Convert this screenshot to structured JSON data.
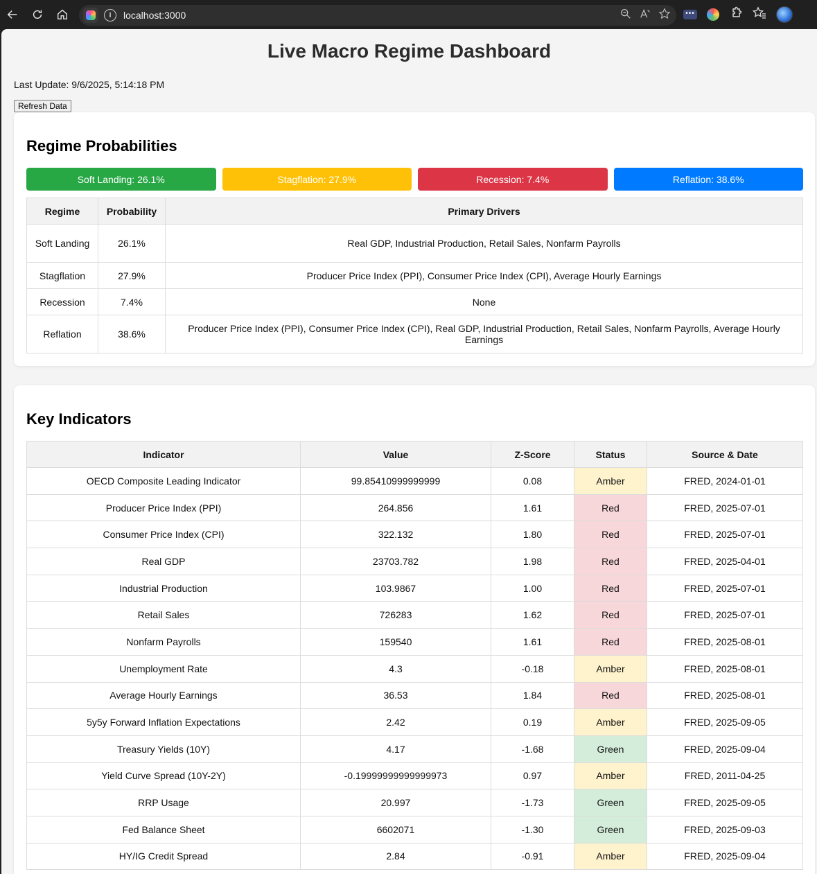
{
  "browser": {
    "url": "localhost:3000"
  },
  "page": {
    "title": "Live Macro Regime Dashboard",
    "last_update": "Last Update: 9/6/2025, 5:14:18 PM",
    "refresh_label": "Refresh Data"
  },
  "regime": {
    "heading": "Regime Probabilities",
    "bars": [
      {
        "label": "Soft Landing: 26.1%",
        "color": "#28a745"
      },
      {
        "label": "Stagflation: 27.9%",
        "color": "#ffc107"
      },
      {
        "label": "Recession: 7.4%",
        "color": "#dc3545"
      },
      {
        "label": "Reflation: 38.6%",
        "color": "#007bff"
      }
    ],
    "columns": [
      "Regime",
      "Probability",
      "Primary Drivers"
    ],
    "rows": [
      {
        "regime": "Soft Landing",
        "probability": "26.1%",
        "drivers": "Real GDP, Industrial Production, Retail Sales, Nonfarm Payrolls"
      },
      {
        "regime": "Stagflation",
        "probability": "27.9%",
        "drivers": "Producer Price Index (PPI), Consumer Price Index (CPI), Average Hourly Earnings"
      },
      {
        "regime": "Recession",
        "probability": "7.4%",
        "drivers": "None"
      },
      {
        "regime": "Reflation",
        "probability": "38.6%",
        "drivers": "Producer Price Index (PPI), Consumer Price Index (CPI), Real GDP, Industrial Production, Retail Sales, Nonfarm Payrolls, Average Hourly Earnings"
      }
    ]
  },
  "indicators": {
    "heading": "Key Indicators",
    "columns": [
      "Indicator",
      "Value",
      "Z-Score",
      "Status",
      "Source & Date"
    ],
    "status_colors": {
      "Red": "#f8d7da",
      "Amber": "#fff3cd",
      "Green": "#d4edda"
    },
    "rows": [
      {
        "indicator": "OECD Composite Leading Indicator",
        "value": "99.85410999999999",
        "z": "0.08",
        "status": "Amber",
        "source": "FRED, 2024-01-01"
      },
      {
        "indicator": "Producer Price Index (PPI)",
        "value": "264.856",
        "z": "1.61",
        "status": "Red",
        "source": "FRED, 2025-07-01"
      },
      {
        "indicator": "Consumer Price Index (CPI)",
        "value": "322.132",
        "z": "1.80",
        "status": "Red",
        "source": "FRED, 2025-07-01"
      },
      {
        "indicator": "Real GDP",
        "value": "23703.782",
        "z": "1.98",
        "status": "Red",
        "source": "FRED, 2025-04-01"
      },
      {
        "indicator": "Industrial Production",
        "value": "103.9867",
        "z": "1.00",
        "status": "Red",
        "source": "FRED, 2025-07-01"
      },
      {
        "indicator": "Retail Sales",
        "value": "726283",
        "z": "1.62",
        "status": "Red",
        "source": "FRED, 2025-07-01"
      },
      {
        "indicator": "Nonfarm Payrolls",
        "value": "159540",
        "z": "1.61",
        "status": "Red",
        "source": "FRED, 2025-08-01"
      },
      {
        "indicator": "Unemployment Rate",
        "value": "4.3",
        "z": "-0.18",
        "status": "Amber",
        "source": "FRED, 2025-08-01"
      },
      {
        "indicator": "Average Hourly Earnings",
        "value": "36.53",
        "z": "1.84",
        "status": "Red",
        "source": "FRED, 2025-08-01"
      },
      {
        "indicator": "5y5y Forward Inflation Expectations",
        "value": "2.42",
        "z": "0.19",
        "status": "Amber",
        "source": "FRED, 2025-09-05"
      },
      {
        "indicator": "Treasury Yields (10Y)",
        "value": "4.17",
        "z": "-1.68",
        "status": "Green",
        "source": "FRED, 2025-09-04"
      },
      {
        "indicator": "Yield Curve Spread (10Y-2Y)",
        "value": "-0.19999999999999973",
        "z": "0.97",
        "status": "Amber",
        "source": "FRED, 2011-04-25"
      },
      {
        "indicator": "RRP Usage",
        "value": "20.997",
        "z": "-1.73",
        "status": "Green",
        "source": "FRED, 2025-09-05"
      },
      {
        "indicator": "Fed Balance Sheet",
        "value": "6602071",
        "z": "-1.30",
        "status": "Green",
        "source": "FRED, 2025-09-03"
      },
      {
        "indicator": "HY/IG Credit Spread",
        "value": "2.84",
        "z": "-0.91",
        "status": "Amber",
        "source": "FRED, 2025-09-04"
      }
    ]
  }
}
